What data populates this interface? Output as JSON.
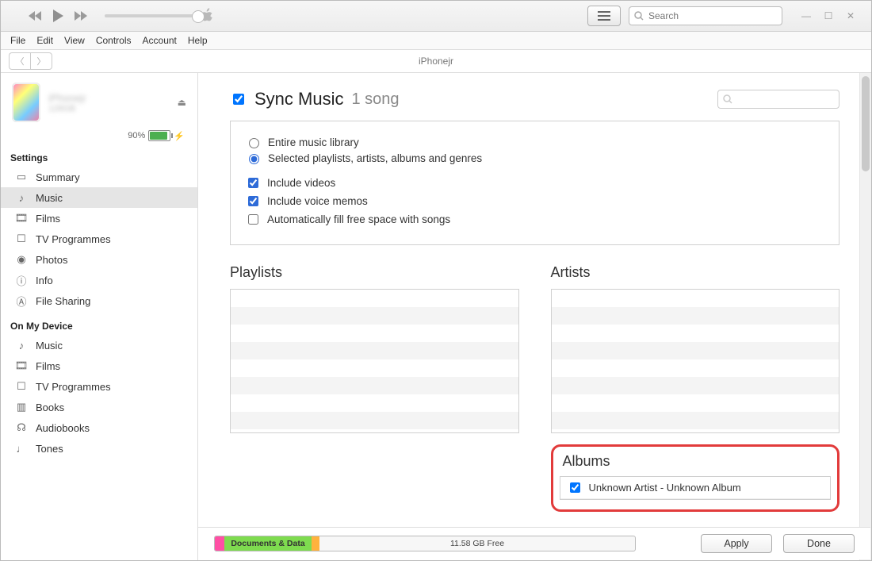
{
  "toolbar": {
    "search_placeholder": "Search"
  },
  "menu": {
    "file": "File",
    "edit": "Edit",
    "view": "View",
    "controls": "Controls",
    "account": "Account",
    "help": "Help"
  },
  "nav_title": "iPhonejr",
  "device": {
    "battery_pct": "90%"
  },
  "sidebar": {
    "settings_label": "Settings",
    "settings": [
      {
        "label": "Summary"
      },
      {
        "label": "Music"
      },
      {
        "label": "Films"
      },
      {
        "label": "TV Programmes"
      },
      {
        "label": "Photos"
      },
      {
        "label": "Info"
      },
      {
        "label": "File Sharing"
      }
    ],
    "device_label": "On My Device",
    "device_items": [
      {
        "label": "Music"
      },
      {
        "label": "Films"
      },
      {
        "label": "TV Programmes"
      },
      {
        "label": "Books"
      },
      {
        "label": "Audiobooks"
      },
      {
        "label": "Tones"
      }
    ]
  },
  "sync": {
    "title": "Sync Music",
    "count": "1 song",
    "opt_entire": "Entire music library",
    "opt_selected": "Selected playlists, artists, albums and genres",
    "opt_videos": "Include videos",
    "opt_memos": "Include voice memos",
    "opt_autofill": "Automatically fill free space with songs"
  },
  "sections": {
    "playlists": "Playlists",
    "artists": "Artists",
    "albums": "Albums"
  },
  "albums": {
    "items": [
      {
        "label": "Unknown Artist - Unknown Album",
        "checked": true
      }
    ]
  },
  "footer": {
    "docs": "Documents & Data",
    "free": "11.58 GB Free",
    "apply": "Apply",
    "done": "Done"
  }
}
